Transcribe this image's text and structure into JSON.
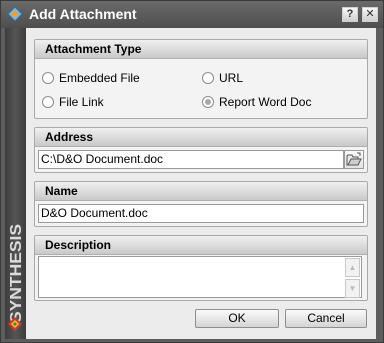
{
  "window": {
    "title": "Add Attachment",
    "help_label": "?",
    "close_label": "✕"
  },
  "sidebar": {
    "brand": "SYNTHESIS"
  },
  "attachment_type": {
    "header": "Attachment Type",
    "options": [
      {
        "label": "Embedded File",
        "selected": false
      },
      {
        "label": "URL",
        "selected": false
      },
      {
        "label": "File Link",
        "selected": false
      },
      {
        "label": "Report Word Doc",
        "selected": true
      }
    ]
  },
  "address": {
    "header": "Address",
    "value": "C:\\D&O Document.doc"
  },
  "name": {
    "header": "Name",
    "value": "D&O Document.doc"
  },
  "description": {
    "header": "Description",
    "value": ""
  },
  "buttons": {
    "ok": "OK",
    "cancel": "Cancel"
  }
}
